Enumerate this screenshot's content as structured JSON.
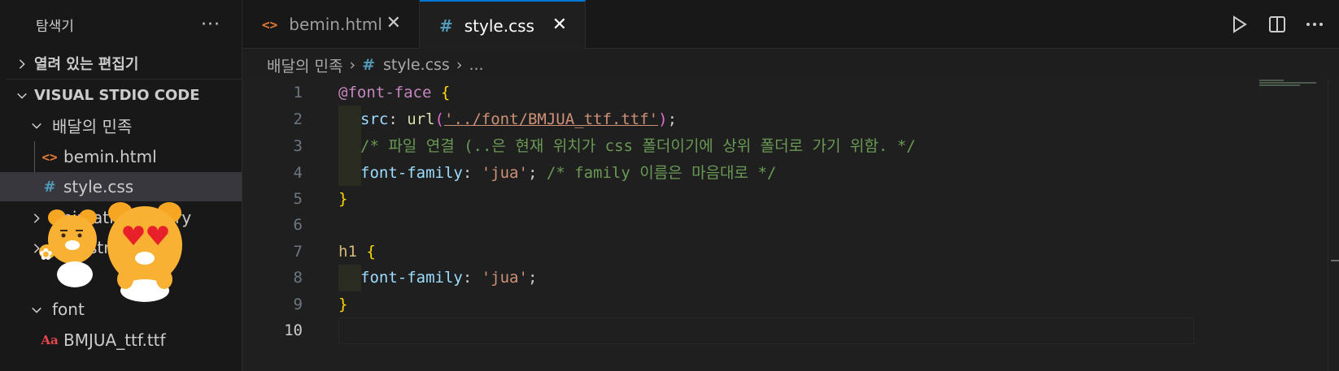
{
  "sidebar": {
    "title": "탐색기",
    "more": "···",
    "sections": {
      "open_editors": "열려 있는 편집기",
      "workspace": "VISUAL STDIO CODE"
    },
    "tree": [
      {
        "label": "배달의 민족"
      },
      {
        "label": "bemin.html"
      },
      {
        "label": "style.css"
      },
      {
        "label": "animation library"
      },
      {
        "label": "bootstrap"
      },
      {
        "label": "font"
      },
      {
        "label": "BMJUA_ttf.ttf"
      }
    ]
  },
  "tabs": [
    {
      "label": "bemin.html",
      "icon": "html-icon",
      "close": "✕"
    },
    {
      "label": "style.css",
      "icon": "css-icon",
      "close": "✕",
      "active": true
    }
  ],
  "breadcrumb": {
    "folder": "배달의 민족",
    "file": "style.css",
    "symbol": "..."
  },
  "editor": {
    "line_numbers": [
      "1",
      "2",
      "3",
      "4",
      "5",
      "6",
      "7",
      "8",
      "9",
      "10"
    ],
    "lines": {
      "l1": {
        "at": "@font-face",
        "brace": " {"
      },
      "l2": {
        "prop": "src",
        "colon": ": ",
        "fn": "url",
        "p_open": "(",
        "str": "'../font/BMJUA_ttf.ttf'",
        "p_close": ")",
        "semi": ";"
      },
      "l3": {
        "comment": "/* 파일 연결 (..은 현재 위치가 css 폴더이기에 상위 폴더로 가기 위함. */"
      },
      "l4": {
        "prop": "font-family",
        "colon": ": ",
        "str": "'jua'",
        "semi": "; ",
        "comment": "/* family 이름은 마음대로 */"
      },
      "l5": {
        "brace": "}"
      },
      "l7": {
        "sel": "h1",
        "brace": " {"
      },
      "l8": {
        "prop": "font-family",
        "colon": ": ",
        "str": "'jua'",
        "semi": ";"
      },
      "l9": {
        "brace": "}"
      }
    }
  },
  "colors": {
    "accent": "#0078d4",
    "background": "#1f1f1f",
    "sidebar": "#181818"
  }
}
